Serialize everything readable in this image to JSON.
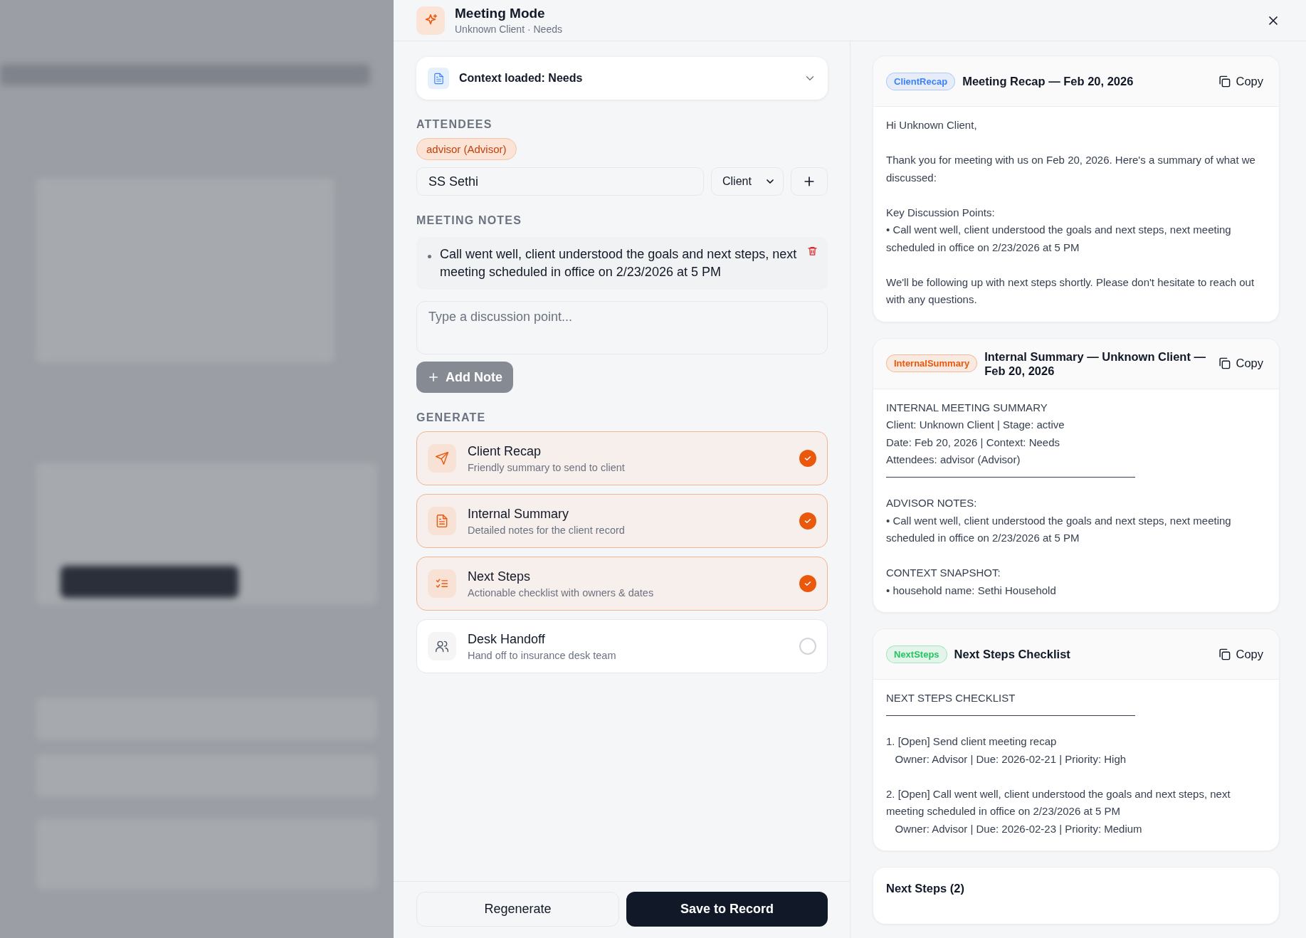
{
  "modal": {
    "title": "Meeting Mode",
    "subtitle": "Unknown Client · Needs"
  },
  "context": {
    "label": "Context loaded: Needs",
    "expanded": false
  },
  "attendees": {
    "heading": "ATTENDEES",
    "chips": [
      "advisor (Advisor)"
    ],
    "name_input": {
      "value": "SS Sethi"
    },
    "role_select": {
      "value": "Client"
    }
  },
  "meeting_notes": {
    "heading": "MEETING NOTES",
    "notes": [
      "Call went well, client understood the goals and next steps, next meeting scheduled in office on 2/23/2026 at 5 PM"
    ],
    "input": {
      "placeholder": "Type a discussion point..."
    },
    "add_button": {
      "label": "Add Note",
      "disabled": true
    }
  },
  "generate": {
    "heading": "GENERATE",
    "options": [
      {
        "kind": "send",
        "title": "Client Recap",
        "description": "Friendly summary to send to client",
        "checked": true
      },
      {
        "kind": "document",
        "title": "Internal Summary",
        "description": "Detailed notes for the client record",
        "checked": true
      },
      {
        "kind": "checklist",
        "title": "Next Steps",
        "description": "Actionable checklist with owners & dates",
        "checked": true
      },
      {
        "kind": "people",
        "title": "Desk Handoff",
        "description": "Hand off to insurance desk team",
        "checked": false
      }
    ]
  },
  "outputs": [
    {
      "tag": "ClientRecap",
      "color": "#3b82f6",
      "title": "Meeting Recap — Feb 20, 2026",
      "copy": "Copy",
      "body": [
        {
          "lines": [
            "Hi Unknown Client,"
          ]
        },
        {
          "lines": [
            "Thank you for meeting with us on Feb 20, 2026. Here's a summary of what we discussed:"
          ]
        },
        {
          "lines": [
            "Key Discussion Points:",
            "• Call went well, client understood the goals and next steps, next meeting scheduled in office on 2/23/2026 at 5 PM"
          ]
        },
        {
          "lines": [
            "We'll be following up with next steps shortly. Please don't hesitate to reach out with any questions."
          ]
        }
      ]
    },
    {
      "tag": "InternalSummary",
      "color": "#ea580c",
      "title": "Internal Summary — Unknown Client — Feb 20, 2026",
      "copy": "Copy",
      "body": [
        {
          "lines": [
            "INTERNAL MEETING SUMMARY",
            "Client: Unknown Client | Stage: active",
            "Date: Feb 20, 2026 | Context: Needs",
            "Attendees: advisor (Advisor)"
          ],
          "rule": true
        },
        {
          "lines": [
            "ADVISOR NOTES:",
            "• Call went well, client understood the goals and next steps, next meeting scheduled in office on 2/23/2026 at 5 PM"
          ]
        },
        {
          "lines": [
            "CONTEXT SNAPSHOT:",
            "• household name: Sethi Household"
          ]
        }
      ]
    },
    {
      "tag": "NextSteps",
      "color": "#22c55e",
      "title": "Next Steps Checklist",
      "copy": "Copy",
      "body": [
        {
          "lines": [
            "NEXT STEPS CHECKLIST"
          ],
          "rule": true
        },
        {
          "lines": [
            "1. [Open] Send client meeting recap",
            "   Owner: Advisor | Due: 2026-02-21 | Priority: High"
          ]
        },
        {
          "lines": [
            "2. [Open] Call went well, client understood the goals and next steps, next meeting scheduled in office on 2/23/2026 at 5 PM",
            "   Owner: Advisor | Due: 2026-02-23 | Priority: Medium"
          ]
        }
      ]
    }
  ],
  "next_steps_panel": {
    "title": "Next Steps (2)"
  },
  "footer": {
    "secondary": "Regenerate",
    "primary": "Save to Record"
  }
}
